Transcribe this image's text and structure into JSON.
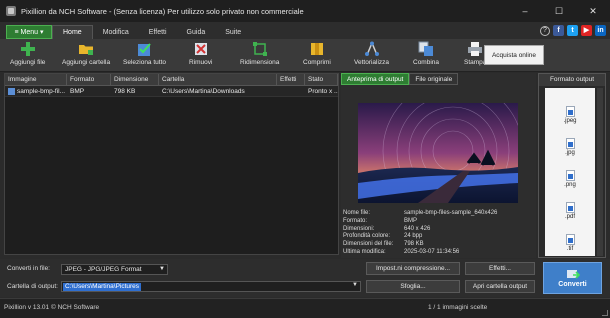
{
  "window": {
    "title": "Pixillion da NCH Software - (Senza licenza) Per utilizzo solo privato non commerciale",
    "controls": [
      "–",
      "☐",
      "✕"
    ]
  },
  "menu_tabs": {
    "menu_label": "Menu",
    "tabs": [
      {
        "label": "Home",
        "active": true
      },
      {
        "label": "Modifica",
        "active": false
      },
      {
        "label": "Effetti",
        "active": false
      },
      {
        "label": "Guida",
        "active": false
      },
      {
        "label": "Suite",
        "active": false
      }
    ],
    "help": "?",
    "social": [
      {
        "name": "facebook",
        "glyph": "f",
        "color": "#3b5998"
      },
      {
        "name": "twitter",
        "glyph": "t",
        "color": "#1da1f2"
      },
      {
        "name": "youtube",
        "glyph": "▶",
        "color": "#e02424"
      },
      {
        "name": "linkedin",
        "glyph": "in",
        "color": "#0a66c2"
      }
    ]
  },
  "toolbar": {
    "buttons": [
      {
        "label": "Aggiungi file",
        "icon": "add-file-icon"
      },
      {
        "label": "Aggiungi cartella",
        "icon": "add-folder-icon"
      },
      {
        "label": "Seleziona tutto",
        "icon": "select-all-icon"
      },
      {
        "label": "Rimuovi",
        "icon": "remove-icon"
      },
      {
        "label": "Ridimensiona",
        "icon": "resize-icon"
      },
      {
        "label": "Comprimi",
        "icon": "compress-icon"
      },
      {
        "label": "Vettorializza",
        "icon": "vectorize-icon"
      },
      {
        "label": "Combina",
        "icon": "combine-icon"
      },
      {
        "label": "Stampa",
        "icon": "print-icon"
      }
    ],
    "more": "»",
    "online_label": "Acquista online"
  },
  "file_list": {
    "columns": [
      "Immagine",
      "Formato",
      "Dimensione",
      "Cartella",
      "Effetti",
      "Stato"
    ],
    "rows": [
      {
        "name": "sample-bmp-fil...",
        "format": "BMP",
        "size": "798 KB",
        "folder": "C:\\Users\\Martina\\Downloads",
        "effects": "",
        "status": "Pronto x ..."
      }
    ]
  },
  "preview": {
    "tabs": [
      "Anteprima di output",
      "File originale"
    ],
    "info": [
      {
        "k": "Nome file:",
        "v": "sample-bmp-files-sample_640x426"
      },
      {
        "k": "Formato:",
        "v": "BMP"
      },
      {
        "k": "Dimensioni:",
        "v": "640 x 426"
      },
      {
        "k": "Profondità colore:",
        "v": "24 bpp"
      },
      {
        "k": "Dimensioni del file:",
        "v": "798 KB"
      },
      {
        "k": "Ultima modifica:",
        "v": "2025-03-07 11:34:56"
      }
    ]
  },
  "output_formats": {
    "title": "Formato output",
    "items": [
      ".jpeg",
      ".jpg",
      ".png",
      ".pdf",
      ".tif"
    ]
  },
  "bottom": {
    "convert_label": "Converti in file:",
    "convert_value": "JPEG - JPG/JPEG Format",
    "output_label": "Cartella di output:",
    "output_value": "C:\\Users\\Martina\\Pictures",
    "compression_button": "Impost.ni compressione...",
    "effects_button": "Effetti...",
    "browse_button": "Sfoglia...",
    "open_folder_button": "Apri cartella output",
    "convert_button": "Converti"
  },
  "status": {
    "left": "Pixillion v 13.01 © NCH Software",
    "right": "1 / 1 immagini scelte"
  }
}
